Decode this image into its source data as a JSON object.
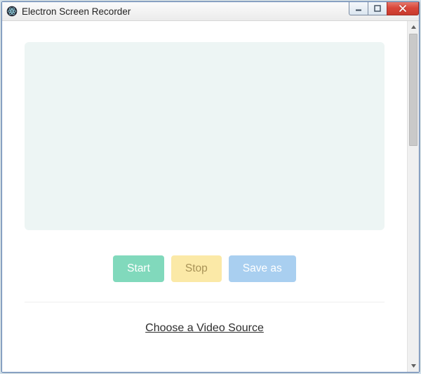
{
  "window": {
    "title": "Electron Screen Recorder"
  },
  "buttons": {
    "start": "Start",
    "stop": "Stop",
    "save": "Save as"
  },
  "link": {
    "choose_source": "Choose a Video Source"
  },
  "colors": {
    "start_bg": "#81d9bc",
    "stop_bg": "#fbe9a7",
    "save_bg": "#a9cff0",
    "preview_bg": "#edf5f4",
    "close_bg": "#d9473a"
  }
}
